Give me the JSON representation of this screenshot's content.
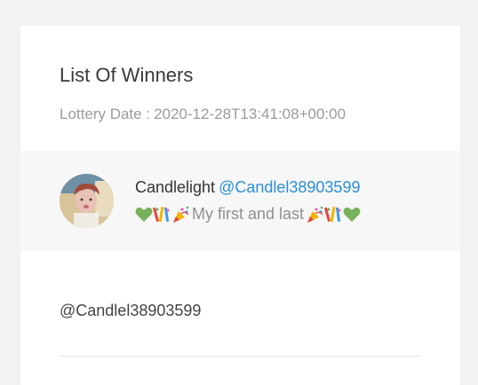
{
  "page": {
    "title": "List Of Winners",
    "lottery_label": "Lottery Date :",
    "lottery_date": "2020-12-28T13:41:08+00:00"
  },
  "winner": {
    "display_name": "Candlelight",
    "handle": "@Candlel38903599",
    "message_text": "My first and last",
    "message_icons": [
      "green-heart-icon",
      "confetti-icon",
      "party-popper-icon"
    ]
  },
  "entries": [
    {
      "handle": "@Candlel38903599"
    }
  ],
  "colors": {
    "background": "#f2f2f2",
    "card": "#ffffff",
    "winner_row": "#f7f7f7",
    "handle_link": "#2b8fd6",
    "muted_text": "#9a9a9a"
  }
}
